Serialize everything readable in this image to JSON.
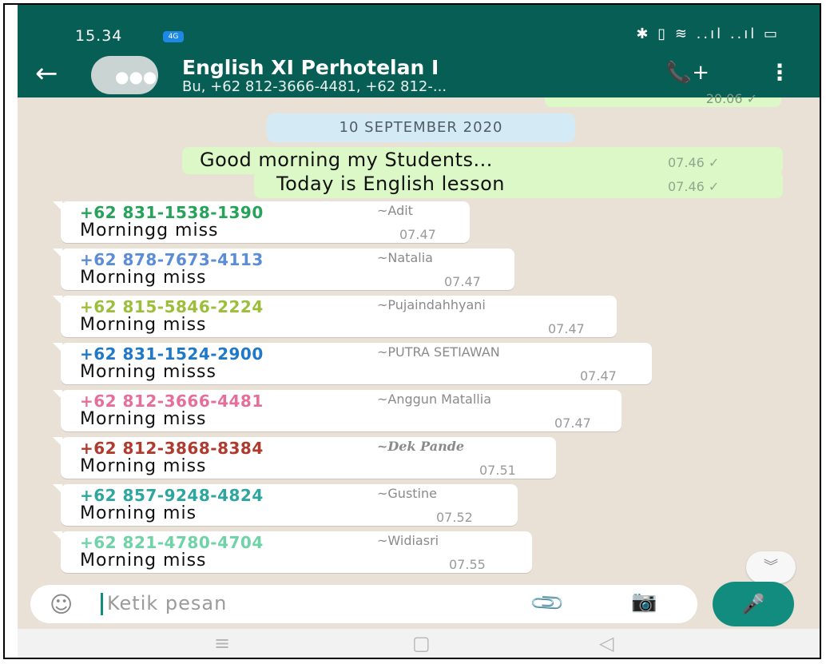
{
  "status_bar": {
    "time": "15.34",
    "notification": "4G",
    "icons": "✱ ▯ ≋ ..ıl ..ıl ▭"
  },
  "header": {
    "back_icon": "←",
    "title": "English XI Perhotelan I",
    "subtitle": "Bu, +62 812-3666-4481, +62 812-...",
    "call_icon": "📞+",
    "menu_icon": "⋮"
  },
  "chat": {
    "peek_time": "20.06 ✓",
    "date_chip": "10 SEPTEMBER 2020",
    "outgoing": [
      {
        "text": "Good morning my Students...",
        "time": "07.46 ✓"
      },
      {
        "text": "Today is English lesson",
        "time": "07.46 ✓"
      }
    ],
    "incoming": [
      {
        "number": "+62 831-1538-1390",
        "name": "~Adit",
        "text": "Morningg miss",
        "time": "07.47",
        "color": "#25a35a"
      },
      {
        "number": "+62 878-7673-4113",
        "name": "~Natalia",
        "text": "Morning miss",
        "time": "07.47",
        "color": "#5b8dd6"
      },
      {
        "number": "+62 815-5846-2224",
        "name": "~Pujaindahhyani",
        "text": "Morning miss",
        "time": "07.47",
        "color": "#9cbe3a"
      },
      {
        "number": "+62 831-1524-2900",
        "name": "~PUTRA SETIAWAN",
        "text": "Morning misss",
        "time": "07.47",
        "color": "#1f78c8"
      },
      {
        "number": "+62 812-3666-4481",
        "name": "~Anggun Matallia",
        "text": "Morning miss",
        "time": "07.47",
        "color": "#e56f9a"
      },
      {
        "number": "+62 812-3868-8384",
        "name": "~Dek Pande",
        "text": "Morning miss",
        "time": "07.51",
        "color": "#b03a2e"
      },
      {
        "number": "+62 857-9248-4824",
        "name": "~Gustine",
        "text": "Morning mis",
        "time": "07.52",
        "color": "#2ea6a0"
      },
      {
        "number": "+62 821-4780-4704",
        "name": "~Widiasri",
        "text": "Morning miss",
        "time": "07.55",
        "color": "#6fd3a8"
      }
    ]
  },
  "input": {
    "placeholder": "Ketik pesan",
    "emoji_icon": "☺",
    "attach_icon": "📎",
    "camera_icon": "📷",
    "mic_icon": "🎤"
  },
  "scroll_icon": "︾",
  "navbar": {
    "menu": "≡",
    "home": "▢",
    "back": "◁"
  }
}
